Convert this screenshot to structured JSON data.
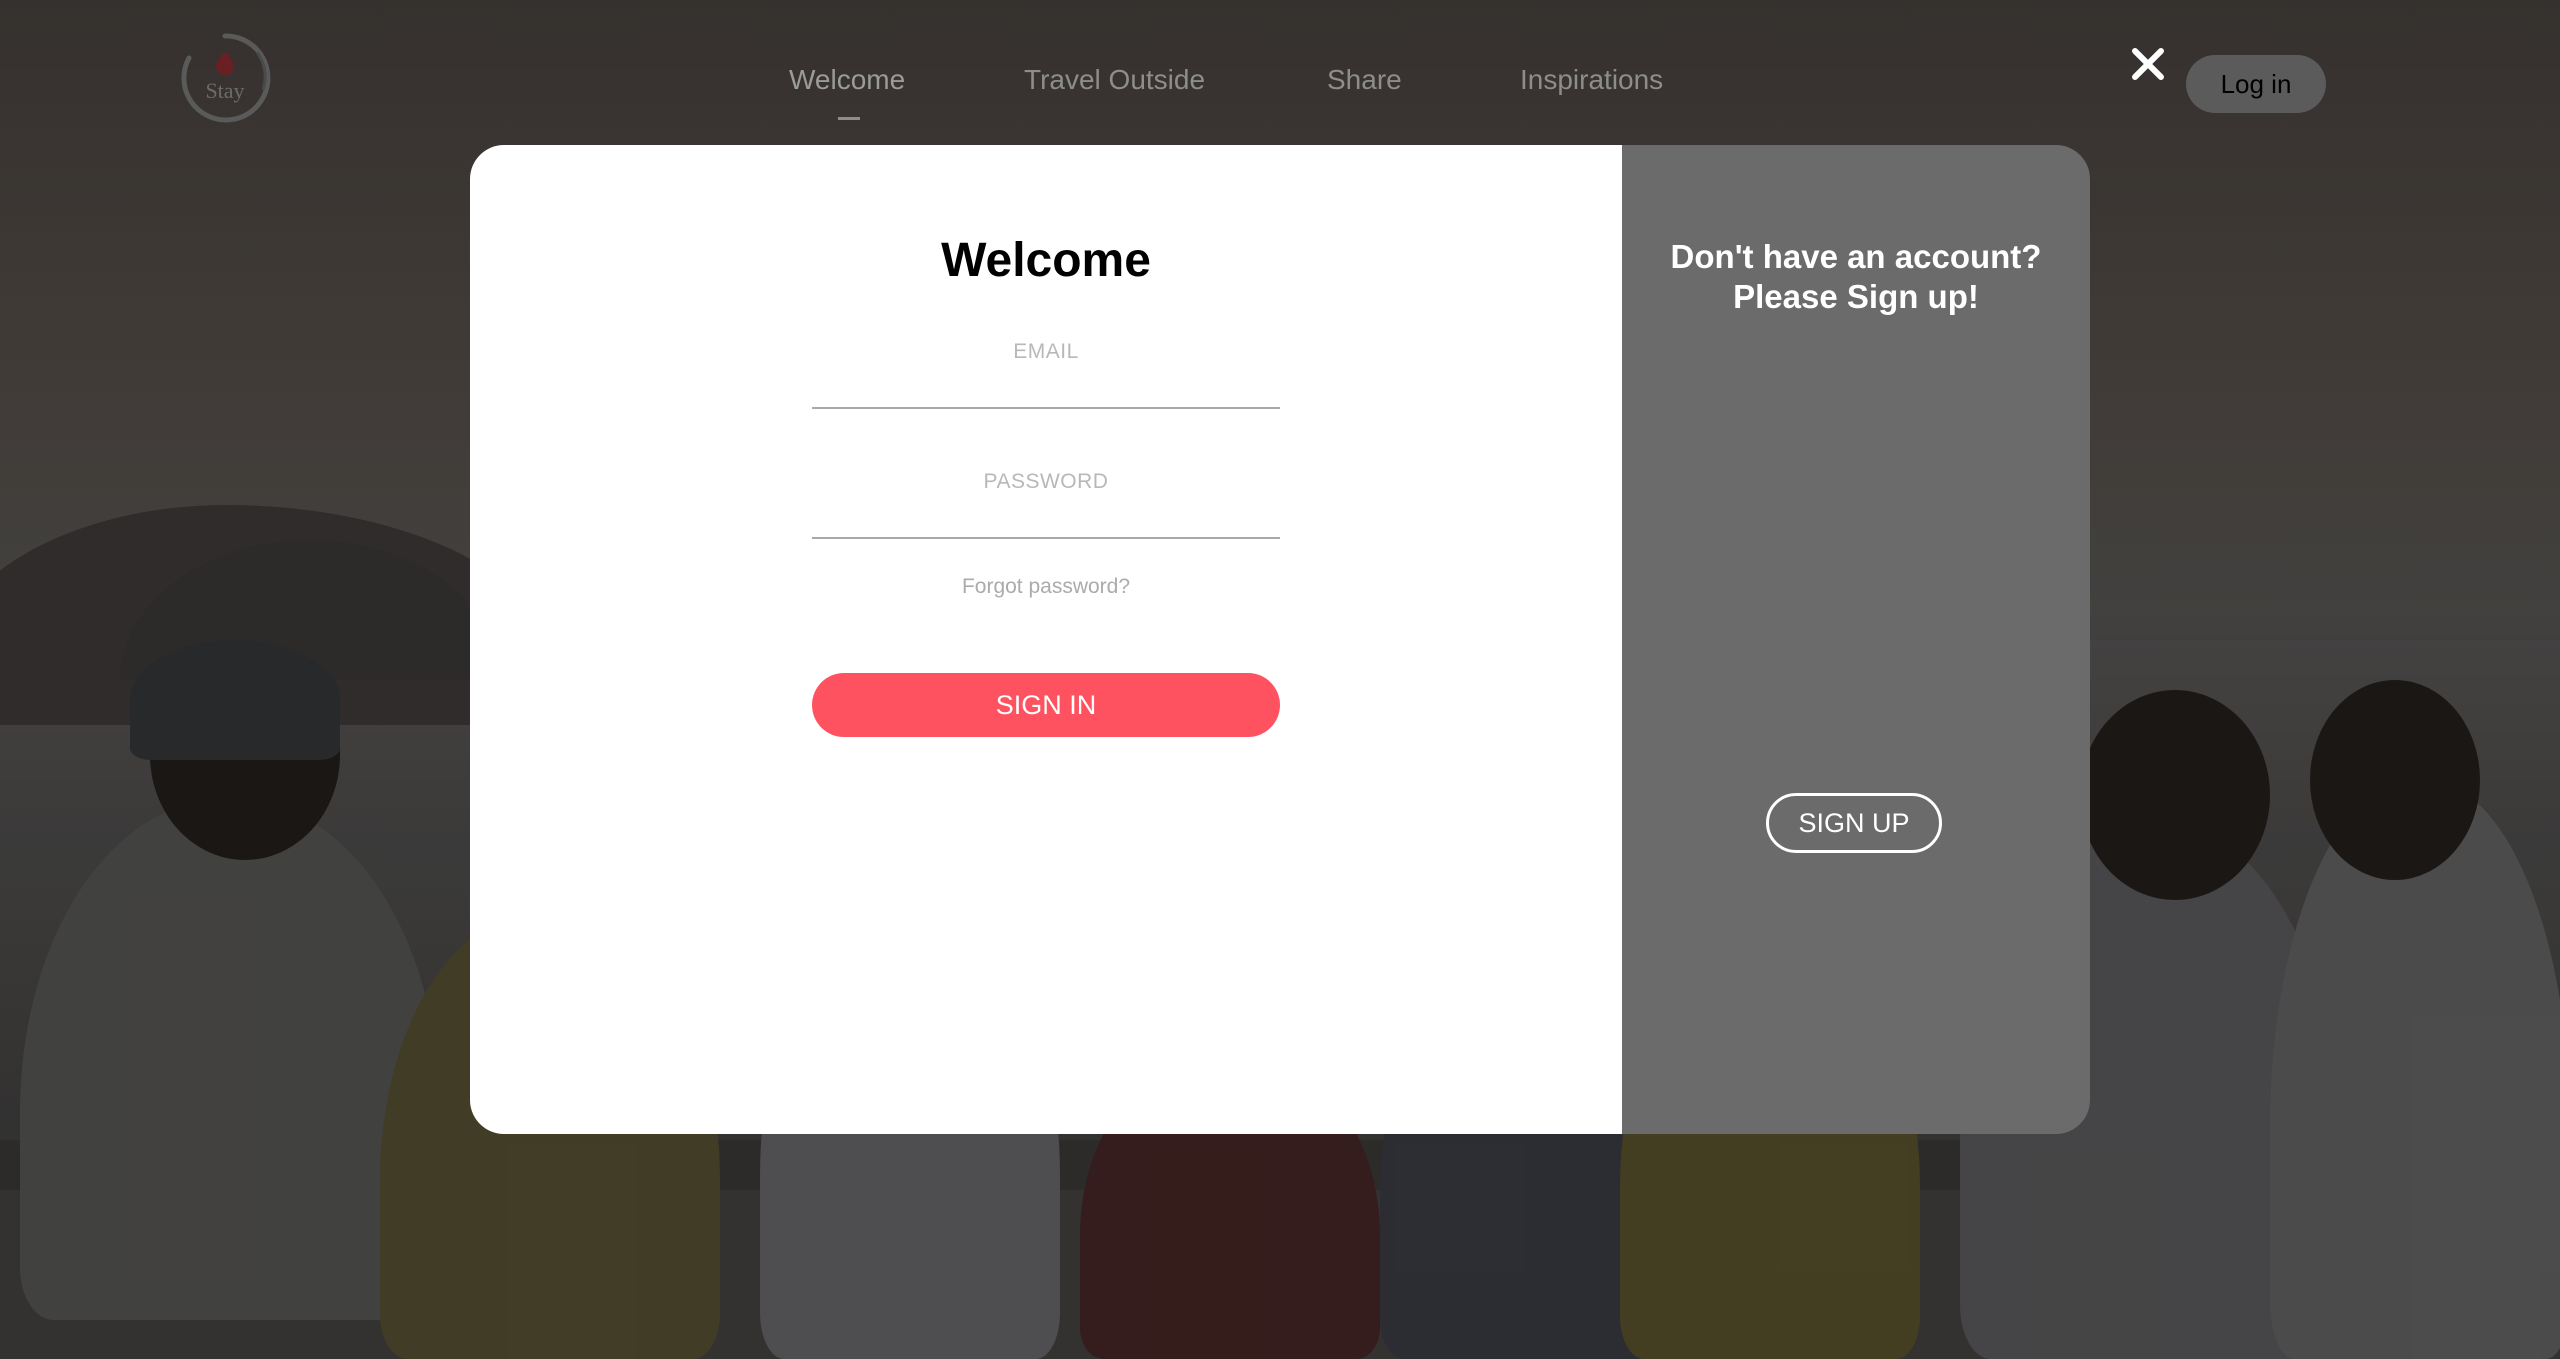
{
  "header": {
    "logo_text": "Stay",
    "nav": [
      {
        "label": "Welcome",
        "active": true
      },
      {
        "label": "Travel Outside",
        "active": false
      },
      {
        "label": "Share",
        "active": false
      },
      {
        "label": "Inspirations",
        "active": false
      }
    ],
    "close_icon": "close-icon",
    "login_label": "Log in"
  },
  "modal": {
    "title": "Welcome",
    "email": {
      "label": "EMAIL",
      "value": ""
    },
    "password": {
      "label": "PASSWORD",
      "value": ""
    },
    "forgot_label": "Forgot password?",
    "signin_label": "SIGN IN",
    "signup_heading_line1": "Don't have an account?",
    "signup_heading_line2": "Please Sign up!",
    "signup_label": "SIGN UP"
  },
  "colors": {
    "accent": "#ff5260",
    "panel_gray": "#6b6b6b",
    "nav_text": "#8d8d8d",
    "login_bg": "#5b5b5b"
  }
}
